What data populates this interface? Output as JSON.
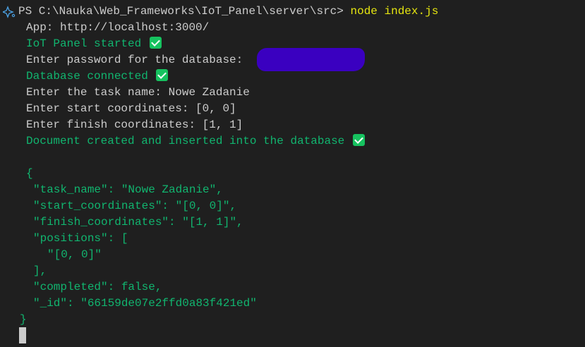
{
  "terminal": {
    "prompt": "PS C:\\Nauka\\Web_Frameworks\\IoT_Panel\\server\\src> ",
    "command": "node index.js",
    "lines": {
      "app_url": "App: http://localhost:3000/",
      "started": "IoT Panel started",
      "password_prompt": "Enter password for the database: ",
      "db_connected": "Database connected",
      "task_name_prompt": "Enter the task name: Nowe Zadanie",
      "start_prompt": "Enter start coordinates: [0, 0]",
      "finish_prompt": "Enter finish coordinates: [1, 1]",
      "doc_created": "Document created and inserted into the database"
    },
    "json_output": {
      "open": "{",
      "task_name": "\"task_name\": \"Nowe Zadanie\",",
      "start": "\"start_coordinates\": \"[0, 0]\",",
      "finish": "\"finish_coordinates\": \"[1, 1]\",",
      "positions_open": "\"positions\": [",
      "position_0": "\"[0, 0]\"",
      "positions_close": "],",
      "completed": "\"completed\": false,",
      "id": "\"_id\": \"66159de07e2ffd0a83f421ed\"",
      "close": "}"
    },
    "colors": {
      "background": "#1f1f1f",
      "text": "#cccccc",
      "success": "#11b56f",
      "command": "#e5e510",
      "redaction": "#3a00c0"
    }
  }
}
